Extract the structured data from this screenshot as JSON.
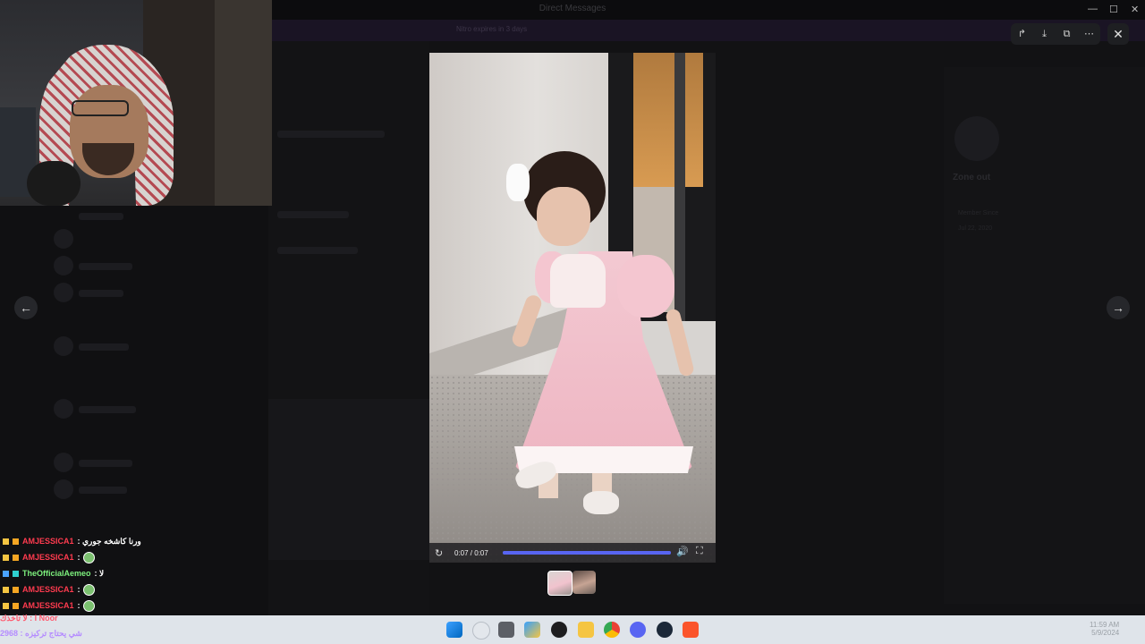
{
  "app": {
    "window_title": "Direct Messages",
    "banner_text": "Nitro expires in 3 days",
    "window_controls": [
      "minimize",
      "maximize",
      "close"
    ]
  },
  "background": {
    "sidebar_header": "Zone out",
    "right_panel_title": "Zone out",
    "right_panel_sub": "Member Since",
    "right_panel_date": "Jul 22, 2020"
  },
  "viewer": {
    "toolbar": [
      {
        "name": "forward-icon",
        "glyph": "↱"
      },
      {
        "name": "download-icon",
        "glyph": "⤓"
      },
      {
        "name": "open-external-icon",
        "glyph": "⧉"
      },
      {
        "name": "more-icon",
        "glyph": "⋯"
      }
    ],
    "close_glyph": "✕",
    "prev_glyph": "←",
    "next_glyph": "→",
    "video": {
      "time_label": "0:07 / 0:07",
      "progress": 1.0,
      "replay_glyph": "↻",
      "volume_glyph": "🔊",
      "fullscreen_glyph": "⛶"
    },
    "thumbnails": [
      {
        "label": "thumbnail-1",
        "selected": true
      },
      {
        "label": "thumbnail-2",
        "selected": false
      }
    ]
  },
  "chat": {
    "messages": [
      {
        "user": "AMJESSICA1",
        "text": ": ورنا كاشخه جوري",
        "color": "#ff3b4f",
        "emoji": false
      },
      {
        "user": "AMJESSICA1",
        "text": ":",
        "color": "#ff3b4f",
        "emoji": true
      },
      {
        "user": "TheOfficialAemeo",
        "text": ": لا",
        "color": "#7df07d",
        "emoji": false
      },
      {
        "user": "AMJESSICA1",
        "text": ":",
        "color": "#ff3b4f",
        "emoji": true
      },
      {
        "user": "AMJESSICA1",
        "text": ":",
        "color": "#ff3b4f",
        "emoji": true
      }
    ],
    "partial_1": "لا تاخذك : I Noor",
    "partial_2": "2968 : شي يحتاج تركيزه",
    "partial_1_color": "#ff5a6e",
    "partial_2_color": "#b58cff"
  },
  "taskbar": {
    "time": "11:59 AM",
    "date": "5/9/2024",
    "icons": [
      "windows-start-icon",
      "search-icon",
      "task-view-icon",
      "store-icon",
      "obs-icon",
      "file-explorer-icon",
      "chrome-icon",
      "discord-icon",
      "steam-icon",
      "brave-icon"
    ]
  },
  "colors": {
    "accent": "#5865f2",
    "viewer_bg": "#0a0a0c",
    "taskbar_bg": "#dfe4ea"
  }
}
